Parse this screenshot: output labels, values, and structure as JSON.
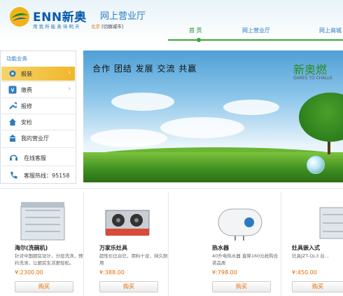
{
  "header": {
    "brand": "ENN新奥",
    "brand_sub": "网上营业厅",
    "slogan": "用 我 所 能   善 待 明 天",
    "city": "北京",
    "city_switch": "[切换城市]",
    "nav": {
      "home": "首 页",
      "hall": "网上营业厅",
      "mall": "网上商城"
    }
  },
  "sidebar": {
    "title": "功能业务",
    "items": [
      {
        "label": "报装",
        "icon": "gear-icon"
      },
      {
        "label": "缴费",
        "icon": "yen-icon"
      },
      {
        "label": "报修",
        "icon": "wrench-icon"
      },
      {
        "label": "安检",
        "icon": "house-icon"
      },
      {
        "label": "我的营业厅",
        "icon": "hall-icon"
      }
    ],
    "online_service": "在线客服",
    "hotline": "客服热线：95158"
  },
  "banner": {
    "slogan": "合作 团结 发展 交流 共赢",
    "brand": "新奥燃",
    "brand_en": "DARES TO CHALLE"
  },
  "products": [
    {
      "name": "海尔(洗碗机)",
      "desc": "针对中国厨房设计，分层洗涤，预约洗涤，让厨房生活更轻松。",
      "price": "¥:2300.00",
      "buy": "购买"
    },
    {
      "name": "万家乐灶具",
      "desc": "超性价比台灶，用料十足，持久耐用",
      "price": "¥:388.00",
      "buy": "购买"
    },
    {
      "name": "热水器",
      "desc": "40升电热水器  直降160元抢购合资品质",
      "price": "¥:798.00",
      "buy": "购买"
    },
    {
      "name": "灶具嵌入式",
      "desc": "灶具JZT-QL3 台...",
      "price": "¥:450.00",
      "buy": "购买"
    }
  ],
  "colors": {
    "brand_blue": "#0a5aa8",
    "nav_green": "#3aa63a",
    "active_yellow": "#f0b72a",
    "price_orange": "#e36b00"
  }
}
